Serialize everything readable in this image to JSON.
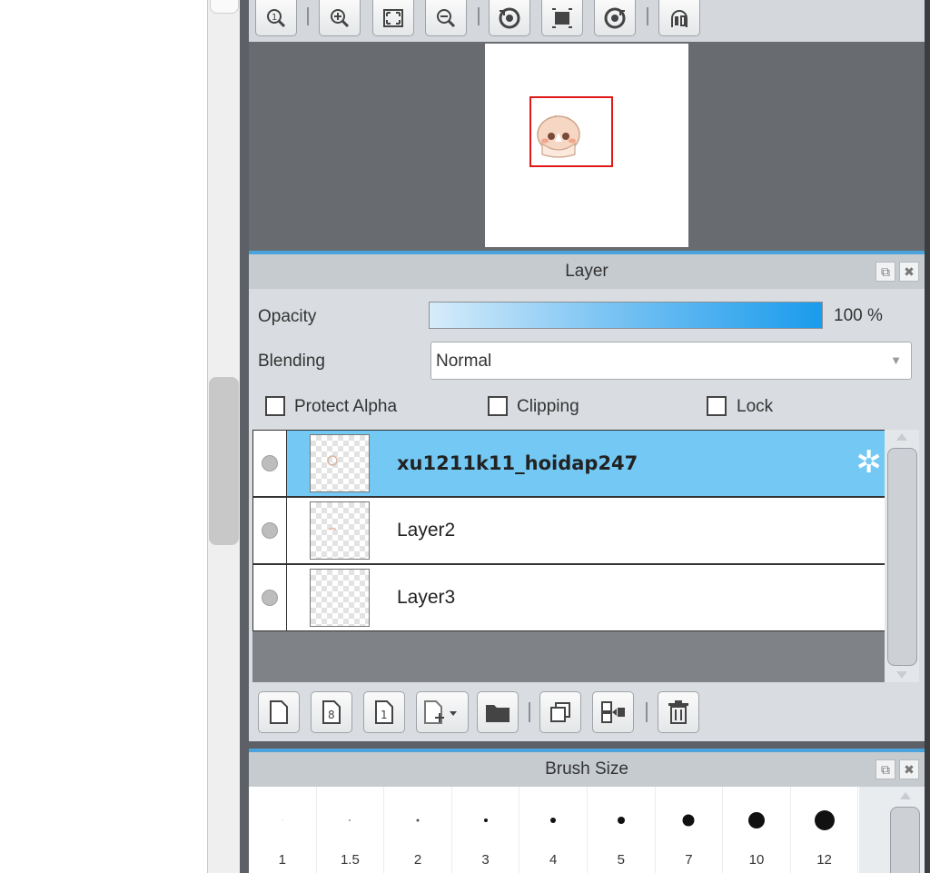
{
  "navigator": {
    "toolbar": [
      {
        "name": "zoom-actual-icon",
        "glyph": "1"
      },
      {
        "name": "zoom-in-icon",
        "glyph": "+"
      },
      {
        "name": "fit-screen-icon",
        "glyph": "⛶"
      },
      {
        "name": "zoom-out-icon",
        "glyph": "−"
      },
      {
        "name": "rotate-left-icon",
        "glyph": "↺"
      },
      {
        "name": "reset-rotation-icon",
        "glyph": "▣"
      },
      {
        "name": "rotate-right-icon",
        "glyph": "↻"
      },
      {
        "name": "flip-horizontal-icon",
        "glyph": "◧"
      }
    ]
  },
  "layer_panel": {
    "title": "Layer",
    "opacity_label": "Opacity",
    "opacity": 100,
    "opacity_text": "100 %",
    "blending_label": "Blending",
    "blending_value": "Normal",
    "checkboxes": {
      "protect_alpha": "Protect Alpha",
      "clipping": "Clipping",
      "lock": "Lock"
    },
    "layers": [
      {
        "name": "xu1211k11_hoidap247",
        "selected": true
      },
      {
        "name": "Layer2",
        "selected": false
      },
      {
        "name": "Layer3",
        "selected": false
      }
    ],
    "toolbar": [
      {
        "name": "new-layer-icon",
        "glyph": ""
      },
      {
        "name": "new-8bit-layer-icon",
        "glyph": "8"
      },
      {
        "name": "new-1bit-layer-icon",
        "glyph": "1"
      },
      {
        "name": "add-layer-menu-icon",
        "glyph": "+▾"
      },
      {
        "name": "folder-icon",
        "glyph": ""
      },
      {
        "name": "duplicate-layer-icon",
        "glyph": "❐"
      },
      {
        "name": "merge-down-icon",
        "glyph": "⇲"
      },
      {
        "name": "trash-icon",
        "glyph": "🗑"
      }
    ]
  },
  "brush_panel": {
    "title": "Brush Size",
    "sizes": [
      "1",
      "1.5",
      "2",
      "3",
      "4",
      "5",
      "7",
      "10",
      "12"
    ]
  },
  "colors": {
    "accent": "#4aa3dd",
    "selected_row": "#74c9f4",
    "navigator_bg": "#686b70",
    "frame": "#e01818"
  }
}
